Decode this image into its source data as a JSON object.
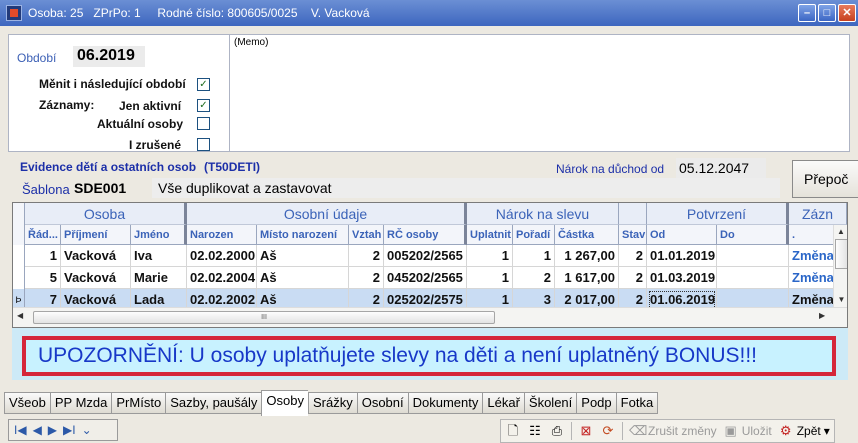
{
  "window": {
    "title": "Osoba: 25   ZPrPo: 1     Rodné číslo: 800605/0025    V. Vacková"
  },
  "top": {
    "obdobi_label": "Období",
    "obdobi_value": "06.2019",
    "menit_label": "Měnit i následující období",
    "zaznamy_label": "Záznamy:",
    "jen_aktivni_label": "Jen aktivní",
    "aktualni_osoby_label": "Aktuální osoby",
    "i_zrusene_label": "I zrušené",
    "memo": "(Memo)",
    "checks": {
      "menit": true,
      "jen_aktivni": true,
      "aktualni_osoby": false,
      "i_zrusene": false
    }
  },
  "evidence": {
    "title": "Evidence dětí a ostatních osob",
    "code": "(T50DETI)",
    "narok_label": "Nárok na důchod od",
    "narok_value": "05.12.2047",
    "prepocet_label": "Přepoč",
    "sablona_label": "Šablona",
    "sablona_code": "SDE001",
    "sablona_text": "Vše duplikovat a zastavovat"
  },
  "grid": {
    "groups": [
      "Osoba",
      "Osobní údaje",
      "Nárok na slevu",
      "Potvrzení",
      "Zázn"
    ],
    "columns": [
      "Řád...",
      "Příjmení",
      "Jméno",
      "Narozen",
      "Místo narození",
      "Vztah",
      "RČ osoby",
      "Uplatnit",
      "Pořadí",
      "Částka",
      "Stav",
      "Od",
      "Do",
      "."
    ],
    "rows": [
      {
        "rad": "1",
        "prijmeni": "Vacková",
        "jmeno": "Iva",
        "narozen": "02.02.2000",
        "misto": "Aš",
        "vztah": "2",
        "rc": "005202/2565",
        "uplatnit": "1",
        "poradi": "1",
        "castka": "1 267,00",
        "stav": "2",
        "od": "01.01.2019",
        "do": "",
        "zaznam": "Změna"
      },
      {
        "rad": "5",
        "prijmeni": "Vacková",
        "jmeno": "Marie",
        "narozen": "02.02.2004",
        "misto": "Aš",
        "vztah": "2",
        "rc": "045202/2565",
        "uplatnit": "1",
        "poradi": "2",
        "castka": "1 617,00",
        "stav": "2",
        "od": "01.03.2019",
        "do": "",
        "zaznam": "Změna"
      },
      {
        "rad": "7",
        "prijmeni": "Vacková",
        "jmeno": "Lada",
        "narozen": "02.02.2002",
        "misto": "Aš",
        "vztah": "2",
        "rc": "025202/2575",
        "uplatnit": "1",
        "poradi": "3",
        "castka": "2 017,00",
        "stav": "2",
        "od": "01.06.2019",
        "do": "",
        "zaznam": "Změna"
      }
    ],
    "selected_row_marker": "Þ",
    "hscroll_grip": "III"
  },
  "warning": "UPOZORNĚNÍ:  U osoby uplatňujete slevy na děti a není uplatněný BONUS!!!",
  "tabs": [
    "Všeob",
    "PP Mzda",
    "PrMísto",
    "Sazby, paušály",
    "Osoby",
    "Srážky",
    "Osobní",
    "Dokumenty",
    "Lékař",
    "Školení",
    "Podp",
    "Fotka"
  ],
  "active_tab": "Osoby",
  "nav": {
    "first": "I◀",
    "prev": "◀",
    "next": "▶",
    "last": "▶I",
    "more": "⌄"
  },
  "toolbar": {
    "zrusit_label": "Zrušit změny",
    "ulozit_label": "Uložit",
    "zpet_label": "Zpět"
  }
}
